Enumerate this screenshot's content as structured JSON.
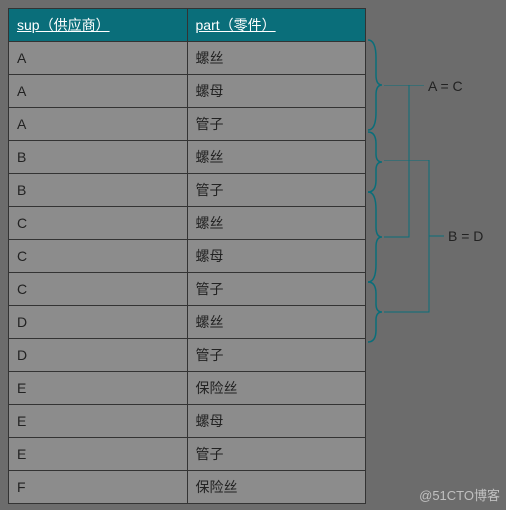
{
  "chart_data": {
    "type": "table",
    "columns": [
      "sup（供应商）",
      "part（零件）"
    ],
    "rows": [
      [
        "A",
        "螺丝"
      ],
      [
        "A",
        "螺母"
      ],
      [
        "A",
        "管子"
      ],
      [
        "B",
        "螺丝"
      ],
      [
        "B",
        "管子"
      ],
      [
        "C",
        "螺丝"
      ],
      [
        "C",
        "螺母"
      ],
      [
        "C",
        "管子"
      ],
      [
        "D",
        "螺丝"
      ],
      [
        "D",
        "管子"
      ],
      [
        "E",
        "保险丝"
      ],
      [
        "E",
        "螺母"
      ],
      [
        "E",
        "管子"
      ],
      [
        "F",
        "保险丝"
      ]
    ],
    "annotations": [
      {
        "label": "A = C",
        "groups": [
          "A",
          "C"
        ]
      },
      {
        "label": "B = D",
        "groups": [
          "B",
          "D"
        ]
      }
    ]
  },
  "headers": {
    "sup": "sup（供应商）",
    "part": "part（零件）"
  },
  "rows": [
    {
      "sup": "A",
      "part": "螺丝"
    },
    {
      "sup": "A",
      "part": "螺母"
    },
    {
      "sup": "A",
      "part": "管子"
    },
    {
      "sup": "B",
      "part": "螺丝"
    },
    {
      "sup": "B",
      "part": "管子"
    },
    {
      "sup": "C",
      "part": "螺丝"
    },
    {
      "sup": "C",
      "part": "螺母"
    },
    {
      "sup": "C",
      "part": "管子"
    },
    {
      "sup": "D",
      "part": "螺丝"
    },
    {
      "sup": "D",
      "part": "管子"
    },
    {
      "sup": "E",
      "part": "保险丝"
    },
    {
      "sup": "E",
      "part": "螺母"
    },
    {
      "sup": "E",
      "part": "管子"
    },
    {
      "sup": "F",
      "part": "保险丝"
    }
  ],
  "ann": {
    "ac": "A = C",
    "bd": "B = D"
  },
  "watermark": "@51CTO博客"
}
